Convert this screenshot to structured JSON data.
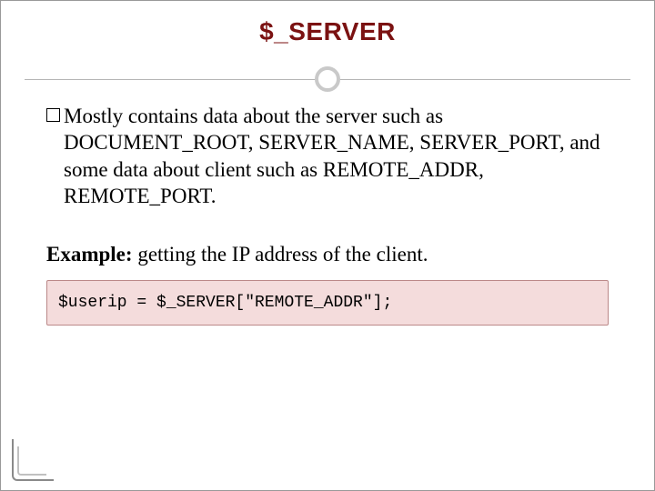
{
  "title": "$_SERVER",
  "bullet": {
    "text": "Mostly contains data about the server such as DOCUMENT_ROOT, SERVER_NAME, SERVER_PORT, and some data about client such as REMOTE_ADDR, REMOTE_PORT."
  },
  "example": {
    "label": "Example:",
    "text": " getting the IP address of the client."
  },
  "code": "$userip = $_SERVER[\"REMOTE_ADDR\"];"
}
